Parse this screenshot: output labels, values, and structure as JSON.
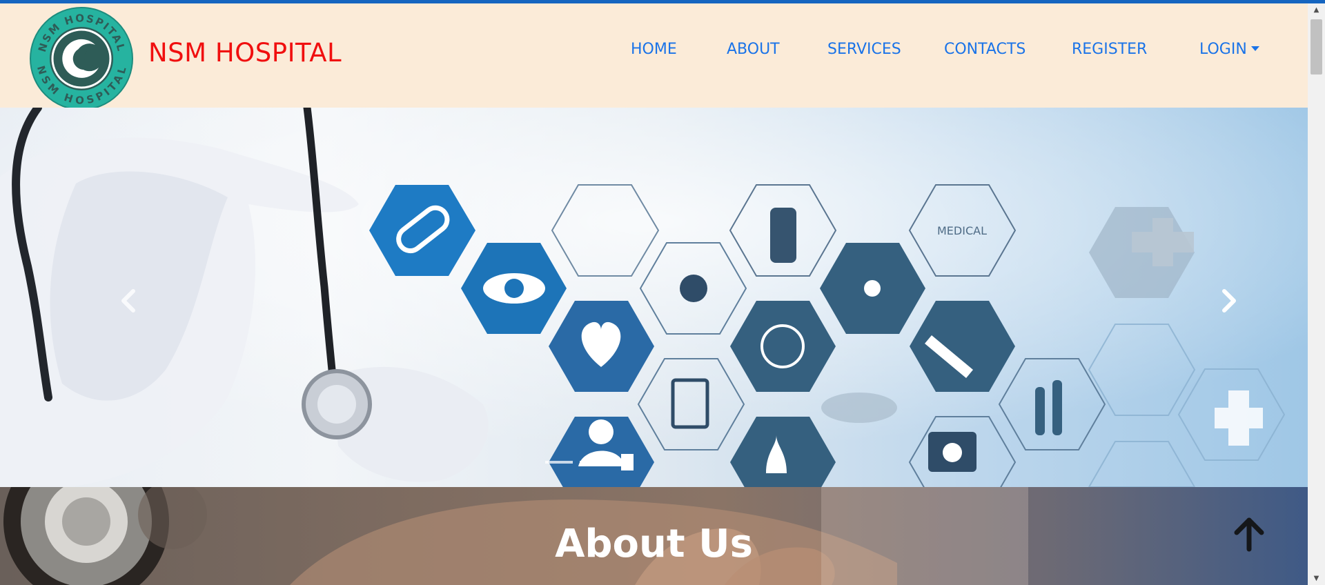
{
  "brand": {
    "name": "NSM HOSPITAL",
    "logo_text": "NSM HOSPITAL",
    "color": "#f00f0f"
  },
  "nav": {
    "items": [
      {
        "label": "HOME"
      },
      {
        "label": "ABOUT"
      },
      {
        "label": "SERVICES"
      },
      {
        "label": "CONTACTS"
      },
      {
        "label": "REGISTER"
      },
      {
        "label": "LOGIN"
      }
    ],
    "link_color": "#1a73e8"
  },
  "hero": {
    "hexagon_label": "MEDICAL",
    "slides_count": 3,
    "active_slide": 3,
    "prev_icon": "chevron-left-icon",
    "next_icon": "chevron-right-icon"
  },
  "about": {
    "title": "About Us"
  },
  "back_to_top": {
    "icon": "arrow-up-icon"
  },
  "colors": {
    "header_bg": "#fbebd8",
    "top_accent": "#1565c0",
    "hex_blue": "#1e7bc4",
    "hex_dark": "#35607f"
  }
}
